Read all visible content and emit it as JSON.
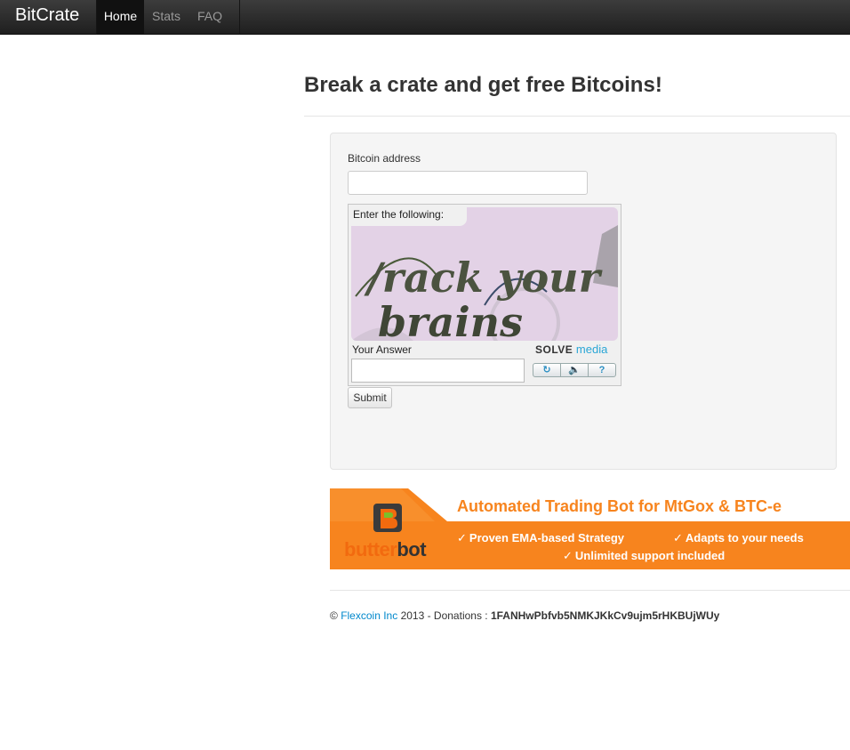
{
  "navbar": {
    "brand": "BitCrate",
    "items": [
      {
        "label": "Home",
        "active": true
      },
      {
        "label": "Stats",
        "active": false
      },
      {
        "label": "FAQ",
        "active": false
      }
    ]
  },
  "main": {
    "title": "Break a crate and get free Bitcoins!",
    "form": {
      "address_label": "Bitcoin address",
      "address_value": "",
      "submit_label": "Submit"
    },
    "captcha": {
      "header": "Enter the following:",
      "challenge_text_line1": "/rack your",
      "challenge_text_line2": "brains",
      "answer_label": "Your Answer",
      "answer_value": "",
      "logo_solve": "SOLVE",
      "logo_media": "media",
      "buttons": [
        {
          "icon": "refresh-icon",
          "glyph": "↻"
        },
        {
          "icon": "audio-icon",
          "glyph": "🔈"
        },
        {
          "icon": "help-icon",
          "glyph": "?"
        }
      ],
      "bg_color": "#e3d2e6"
    }
  },
  "banner": {
    "headline": "Automated Trading Bot for MtGox & BTC-e",
    "features": [
      "Proven EMA-based Strategy",
      "Adapts to your needs",
      "Unlimited support included"
    ],
    "brand_part1": "butter",
    "brand_part2": "bot",
    "accent_color": "#f7841e"
  },
  "footer": {
    "copyright": "©",
    "company": "Flexcoin Inc",
    "year_text": "2013 - Donations :",
    "donation_address": "1FANHwPbfvb5NMKJKkCv9ujm5rHKBUjWUy"
  }
}
